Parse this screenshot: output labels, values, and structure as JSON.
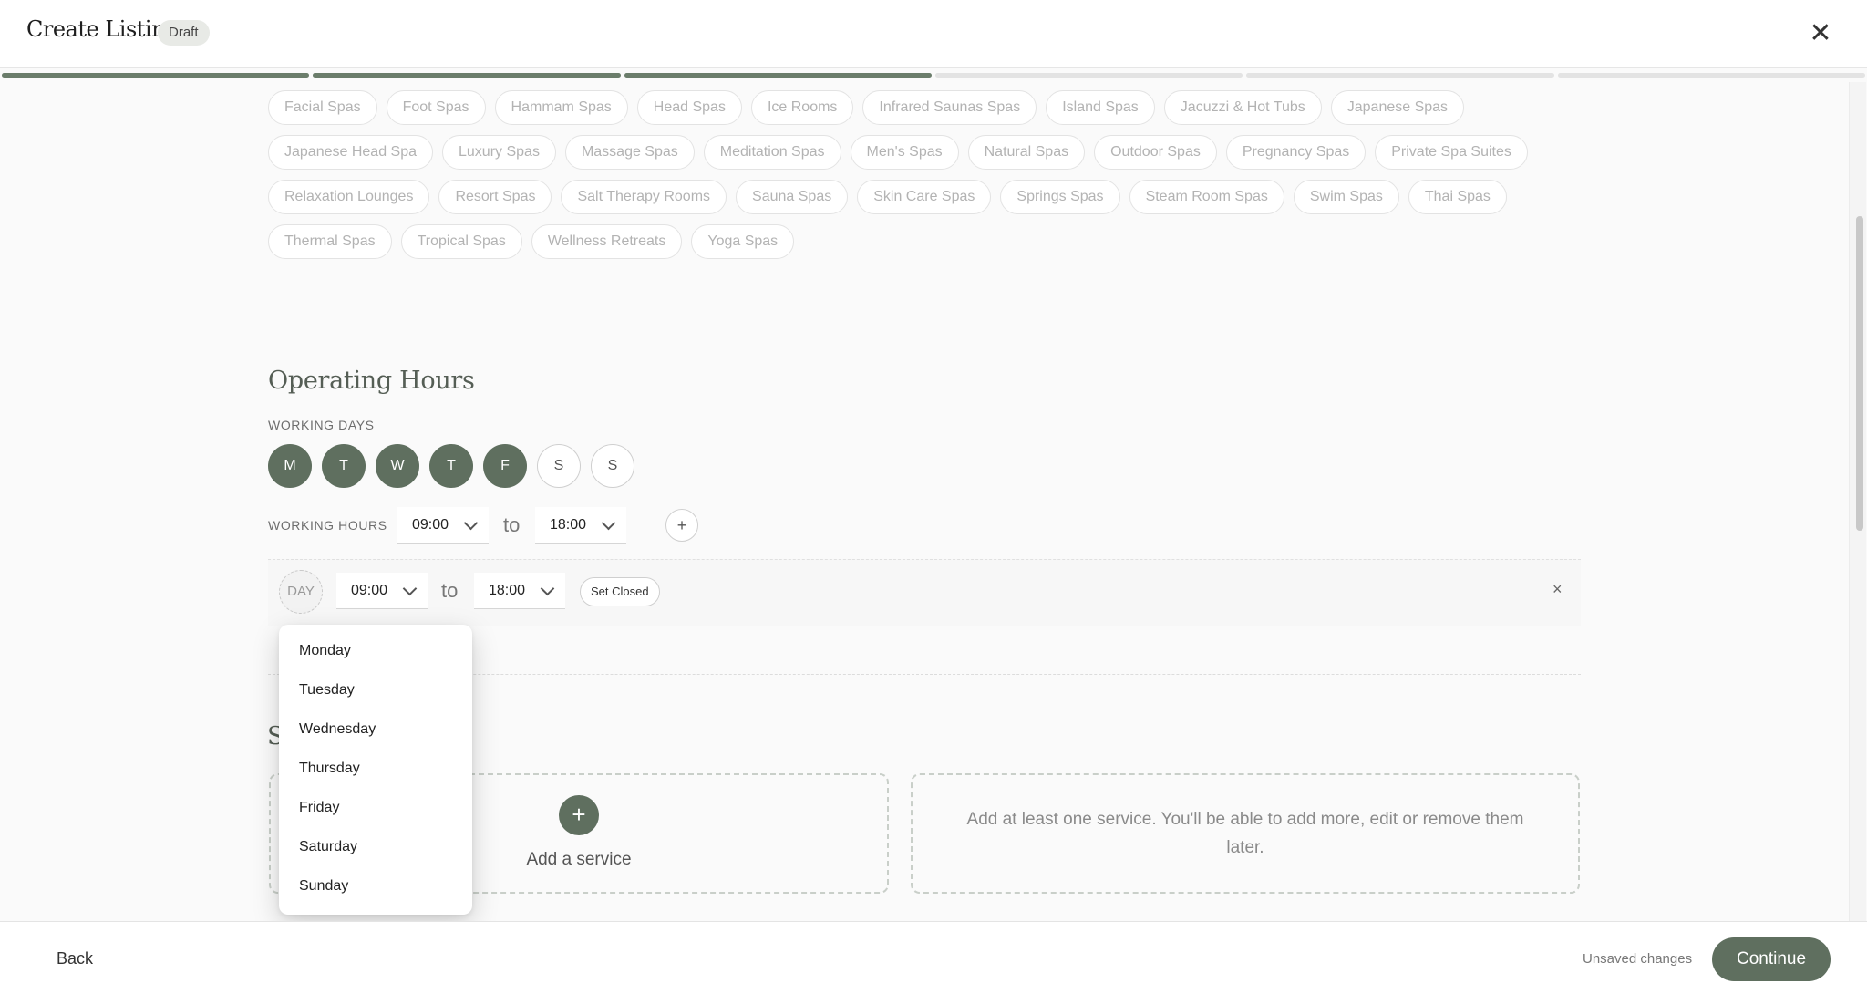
{
  "header": {
    "title": "Create Listing",
    "badge": "Draft",
    "close_icon": "close-icon"
  },
  "progress": {
    "total_steps": 6,
    "completed_steps": 3
  },
  "categories": [
    "Facial Spas",
    "Foot Spas",
    "Hammam Spas",
    "Head Spas",
    "Ice Rooms",
    "Infrared Saunas Spas",
    "Island Spas",
    "Jacuzzi & Hot Tubs",
    "Japanese Spas",
    "Japanese Head Spa",
    "Luxury Spas",
    "Massage Spas",
    "Meditation Spas",
    "Men's Spas",
    "Natural Spas",
    "Outdoor Spas",
    "Pregnancy Spas",
    "Private Spa Suites",
    "Relaxation Lounges",
    "Resort Spas",
    "Salt Therapy Rooms",
    "Sauna Spas",
    "Skin Care Spas",
    "Springs Spas",
    "Steam Room Spas",
    "Swim Spas",
    "Thai Spas",
    "Thermal Spas",
    "Tropical Spas",
    "Wellness Retreats",
    "Yoga Spas"
  ],
  "operating_hours": {
    "title": "Operating Hours",
    "working_days_label": "WORKING DAYS",
    "days": [
      {
        "letter": "M",
        "selected": true
      },
      {
        "letter": "T",
        "selected": true
      },
      {
        "letter": "W",
        "selected": true
      },
      {
        "letter": "T",
        "selected": true
      },
      {
        "letter": "F",
        "selected": true
      },
      {
        "letter": "S",
        "selected": false
      },
      {
        "letter": "S",
        "selected": false
      }
    ],
    "working_hours_label": "WORKING HOURS",
    "start": "09:00",
    "to": "to",
    "end": "18:00",
    "add": "+"
  },
  "exception_row": {
    "day": "DAY",
    "start": "09:00",
    "to": "to",
    "end": "18:00",
    "set_closed": "Set Closed",
    "remove": "×"
  },
  "day_dropdown": {
    "options": [
      "Monday",
      "Tuesday",
      "Wednesday",
      "Thursday",
      "Friday",
      "Saturday",
      "Sunday"
    ]
  },
  "services": {
    "title_partial": "S",
    "add_icon": "+",
    "add_label": "Add a service",
    "info": "Add at least one service. You'll be able to add more, edit or remove them later."
  },
  "footer": {
    "back": "Back",
    "status": "Unsaved changes",
    "continue": "Continue"
  },
  "colors": {
    "accent": "#5f6f5f",
    "progress_done": "#6b7d6b",
    "chip_text": "#b3b3b3"
  }
}
